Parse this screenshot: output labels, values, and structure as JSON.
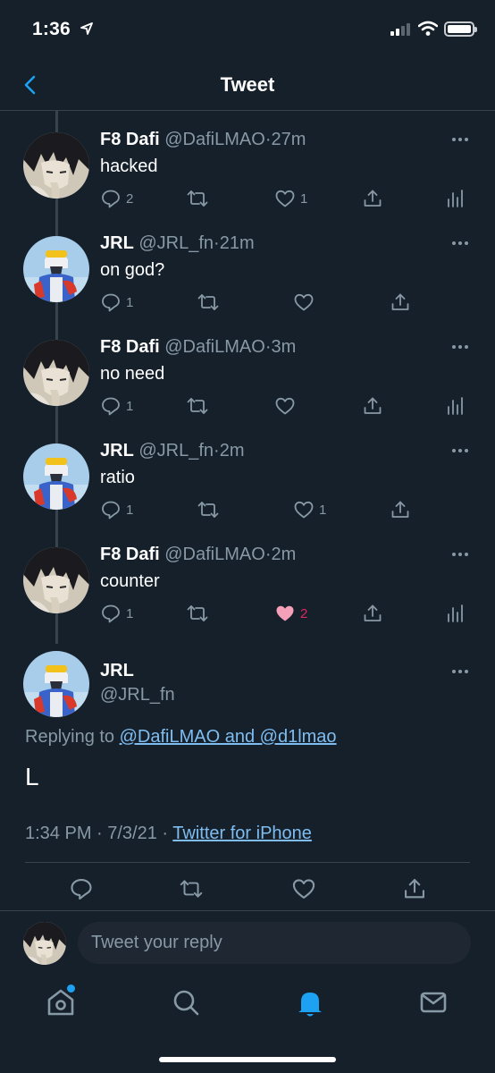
{
  "status_bar": {
    "time": "1:36"
  },
  "nav": {
    "title": "Tweet"
  },
  "thread": [
    {
      "name": "F8 Dafi",
      "handle": "@DafiLMAO",
      "time": "27m",
      "text": "hacked",
      "replies": "2",
      "retweets": "",
      "likes": "1",
      "liked": false,
      "analytics": true,
      "avatar": "anime"
    },
    {
      "name": "JRL",
      "handle": "@JRL_fn",
      "time": "21m",
      "text": "on god?",
      "replies": "1",
      "retweets": "",
      "likes": "",
      "liked": false,
      "analytics": false,
      "avatar": "robot"
    },
    {
      "name": "F8 Dafi",
      "handle": "@DafiLMAO",
      "time": "3m",
      "text": "no need",
      "replies": "1",
      "retweets": "",
      "likes": "",
      "liked": false,
      "analytics": true,
      "avatar": "anime"
    },
    {
      "name": "JRL",
      "handle": "@JRL_fn",
      "time": "2m",
      "text": "ratio",
      "replies": "1",
      "retweets": "",
      "likes": "1",
      "liked": false,
      "analytics": false,
      "avatar": "robot"
    },
    {
      "name": "F8 Dafi",
      "handle": "@DafiLMAO",
      "time": "2m",
      "text": "counter",
      "replies": "1",
      "retweets": "",
      "likes": "2",
      "liked": true,
      "analytics": true,
      "avatar": "anime"
    }
  ],
  "main_tweet": {
    "name": "JRL",
    "handle": "@JRL_fn",
    "replying_prefix": "Replying to",
    "replying_to": "@DafiLMAO and @d1lmao",
    "text": "L",
    "timestamp": "1:34 PM · 7/3/21 ·",
    "source": "Twitter for iPhone"
  },
  "reply": {
    "placeholder": "Tweet your reply"
  },
  "colors": {
    "background": "#15202b",
    "accent": "#1da1f2",
    "secondary_text": "#8899a6",
    "like": "#e0245e"
  }
}
